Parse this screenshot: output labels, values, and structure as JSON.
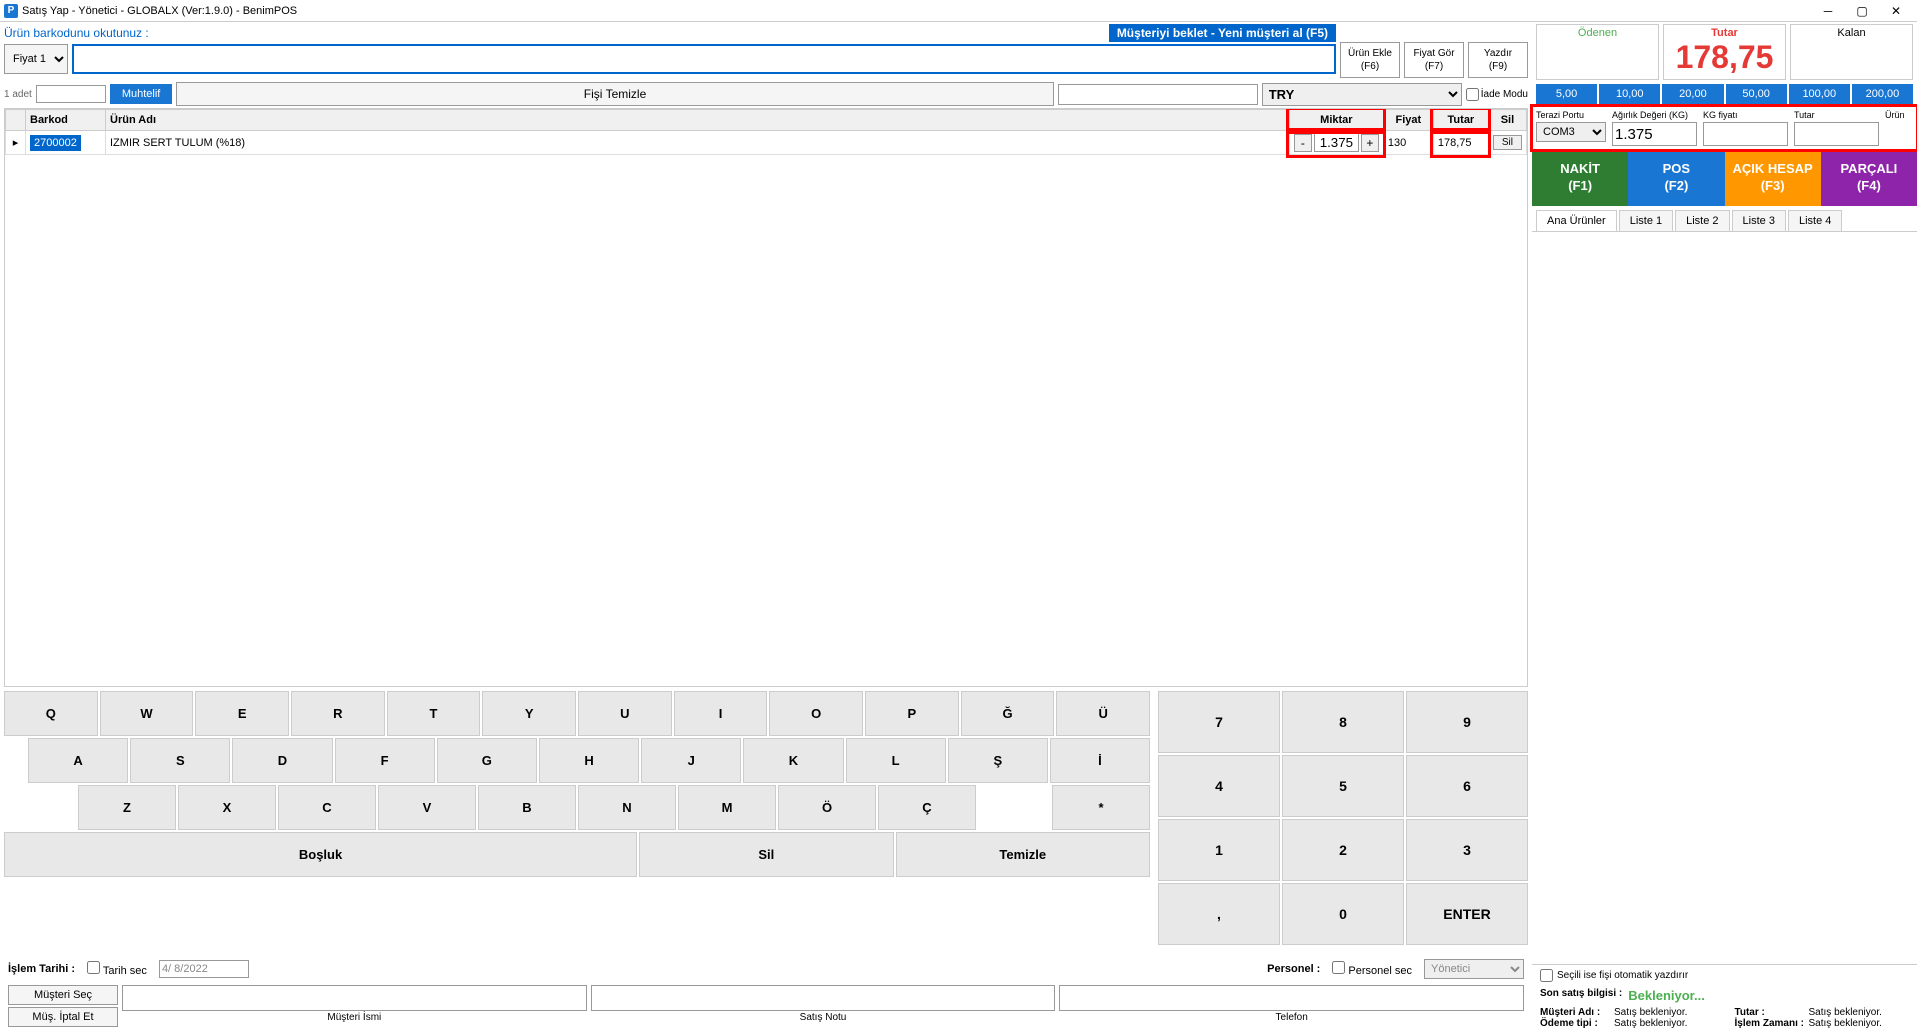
{
  "window": {
    "title": "Satış Yap - Yönetici - GLOBALX (Ver:1.9.0) - BenimPOS",
    "icon_letter": "P"
  },
  "barcode": {
    "label": "Ürün barkodunu okutunuz :",
    "price_option": "Fiyat 1",
    "hold_customer": "Müşteriyi beklet - Yeni müşteri al (F5)"
  },
  "action_buttons": {
    "urun_ekle": "Ürün Ekle\n(F6)",
    "fiyat_gor": "Fiyat Gör\n(F7)",
    "yazdir": "Yazdır\n(F9)"
  },
  "second_row": {
    "adet": "1 adet",
    "muhtelif": "Muhtelif",
    "clear": "Fişi Temizle",
    "currency": "TRY",
    "iade": "İade Modu"
  },
  "grid": {
    "headers": {
      "barkod": "Barkod",
      "urun": "Ürün Adı",
      "miktar": "Miktar",
      "fiyat": "Fiyat",
      "tutar": "Tutar",
      "sil": "Sil"
    },
    "rows": [
      {
        "barkod": "2700002",
        "urun": "IZMIR SERT TULUM (%18)",
        "miktar": "1.375",
        "fiyat": "130",
        "tutar": "178,75"
      }
    ]
  },
  "keyboard": {
    "row1": [
      "Q",
      "W",
      "E",
      "R",
      "T",
      "Y",
      "U",
      "I",
      "O",
      "P",
      "Ğ",
      "Ü"
    ],
    "row2": [
      "A",
      "S",
      "D",
      "F",
      "G",
      "H",
      "J",
      "K",
      "L",
      "Ş",
      "İ"
    ],
    "row3": [
      "Z",
      "X",
      "C",
      "V",
      "B",
      "N",
      "M",
      "Ö",
      "Ç"
    ],
    "star": "*",
    "space": "Boşluk",
    "del": "Sil",
    "clear": "Temizle",
    "numpad": [
      [
        "7",
        "8",
        "9"
      ],
      [
        "4",
        "5",
        "6"
      ],
      [
        "1",
        "2",
        "3"
      ],
      [
        ",",
        "0",
        "ENTER"
      ]
    ]
  },
  "bottom": {
    "islem_tarihi": "İşlem Tarihi :",
    "tarih_sec": "Tarih sec",
    "date": "4/ 8/2022",
    "personel": "Personel :",
    "personel_sec": "Personel sec",
    "personel_val": "Yönetici",
    "musteri_sec": "Müşteri Seç",
    "mus_iptal": "Müş. İptal Et",
    "musteri_ismi": "Müşteri İsmi",
    "satis_notu": "Satış Notu",
    "telefon": "Telefon"
  },
  "totals": {
    "odenen": "Ödenen",
    "tutar": "Tutar",
    "tutar_val": "178,75",
    "kalan": "Kalan"
  },
  "quick_amounts": [
    "5,00",
    "10,00",
    "20,00",
    "50,00",
    "100,00",
    "200,00"
  ],
  "scale": {
    "port_label": "Terazi Portu",
    "port": "COM3",
    "weight_label": "Ağırlık Değeri (KG)",
    "weight": "1.375",
    "kg_price_label": "KG fiyatı",
    "tutar_label": "Tutar",
    "urun_label": "Ürün"
  },
  "payments": {
    "nakit": "NAKİT\n(F1)",
    "pos": "POS\n(F2)",
    "acik": "AÇIK HESAP\n(F3)",
    "parcali": "PARÇALI\n(F4)"
  },
  "product_tabs": [
    "Ana Ürünler",
    "Liste 1",
    "Liste 2",
    "Liste 3",
    "Liste 4"
  ],
  "right_footer": {
    "auto_print": "Seçili ise fişi otomatik yazdırır",
    "last_sale_label": "Son satış bilgisi :",
    "last_sale_val": "Bekleniyor...",
    "musteri_adi": "Müşteri Adı :",
    "odeme_tipi": "Ödeme tipi :",
    "tutar": "Tutar :",
    "islem_zamani": "İşlem Zamanı :",
    "waiting": "Satış bekleniyor."
  }
}
